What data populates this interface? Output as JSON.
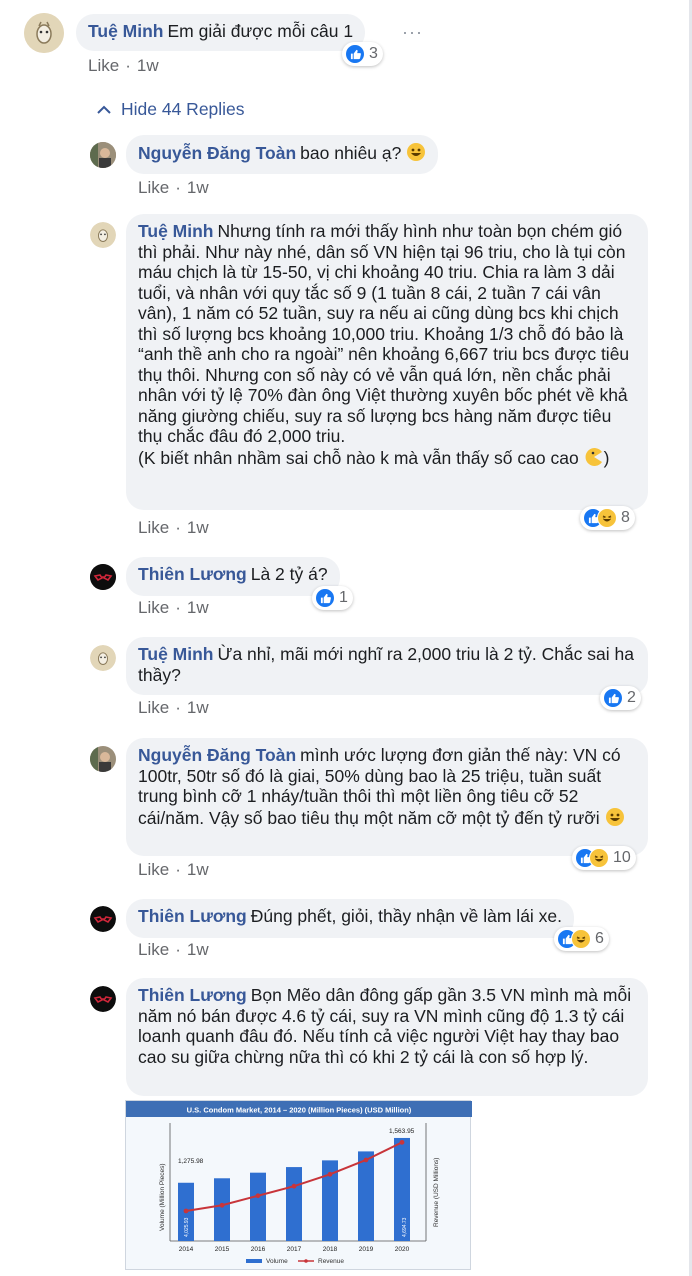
{
  "top": {
    "author": "Tuệ Minh",
    "text": "Em giải được mỗi câu 1",
    "reaction_count": "3",
    "like": "Like",
    "time": "1w",
    "more": "···"
  },
  "hide_replies": "Hide 44 Replies",
  "replies": [
    {
      "author": "Nguyễn Đăng Toàn",
      "text": "bao nhiêu ạ?",
      "like": "Like",
      "time": "1w"
    },
    {
      "author": "Tuệ Minh",
      "text": "Nhưng tính ra mới thấy hình như toàn bọn chém gió thì phải. Như này nhé, dân số VN hiện tại 96 triu, cho là tụi còn máu chịch là từ 15-50, vị chi khoảng 40 triu. Chia ra làm 3 dải tuổi, và nhân với quy tắc số 9 (1 tuần 8 cái, 2 tuần 7 cái vân vân), 1 năm có 52 tuần, suy ra nếu ai cũng dùng bcs khi chịch thì số lượng bcs khoảng 10,000 triu. Khoảng 1/3 chỗ đó bảo là “anh thề anh cho ra ngoài” nên khoảng 6,667 triu bcs được tiêu thụ thôi. Nhưng con số này có vẻ vẫn quá lớn, nền chắc phải nhân với tỷ lệ 70% đàn ông Việt thường xuyên bốc phét về khả năng giường chiếu, suy ra số lượng bcs hàng năm được tiêu thụ chắc đâu đó 2,000 triu.\n(K biết nhân nhầm sai chỗ nào k mà vẫn thấy số cao cao",
      "text_end": ")",
      "reaction_count": "8",
      "like": "Like",
      "time": "1w"
    },
    {
      "author": "Thiên Lương",
      "text": "Là 2 tỷ á?",
      "reaction_count": "1",
      "like": "Like",
      "time": "1w"
    },
    {
      "author": "Tuệ Minh",
      "text": "Ừa nhỉ, mãi mới nghĩ ra 2,000 triu là 2 tỷ. Chắc sai ha thầy?",
      "reaction_count": "2",
      "like": "Like",
      "time": "1w"
    },
    {
      "author": "Nguyễn Đăng Toàn",
      "text": "mình ước lượng đơn giản thế này: VN có 100tr, 50tr số đó là giai, 50% dùng bao là 25 triệu, tuần suất trung bình cỡ 1 nháy/tuần thôi thì một liền ông tiêu cỡ 52 cái/năm. Vậy số bao tiêu thụ một năm cỡ một tỷ đến tỷ rưỡi",
      "reaction_count": "10",
      "like": "Like",
      "time": "1w"
    },
    {
      "author": "Thiên Lương",
      "text": "Đúng phết, giỏi, thầy nhận về làm lái xe.",
      "reaction_count": "6",
      "like": "Like",
      "time": "1w"
    },
    {
      "author": "Thiên Lương",
      "text": "Bọn Mẽo dân đông gấp gần 3.5 VN mình mà mỗi năm nó bán được 4.6 tỷ cái, suy ra VN mình cũng độ 1.3 tỷ cái loanh quanh đâu đó. Nếu tính cả việc người Việt hay thay bao cao su giữa chừng nữa thì có khi 2 tỷ cái là con số hợp lý."
    }
  ],
  "chart_data": {
    "type": "bar",
    "title": "U.S. Condom Market, 2014 – 2020 (Million Pieces) (USD Million)",
    "categories": [
      "2014",
      "2015",
      "2016",
      "2017",
      "2018",
      "2019",
      "2020"
    ],
    "series": [
      {
        "name": "Volume",
        "values": [
          520,
          560,
          610,
          660,
          720,
          800,
          920
        ]
      },
      {
        "name": "Revenue",
        "values": [
          1275.98,
          1300,
          1340,
          1380,
          1430,
          1490,
          1563.95
        ]
      }
    ],
    "value_labels": {
      "first": "1,275.98",
      "last": "1,563.95",
      "bar_first": "4,025.93",
      "bar_last": "4,694.73"
    },
    "ylabel": "Volume (Million Pieces)",
    "ylabel_right": "Revenue (USD Millions)",
    "colors": {
      "volume": "#2f6fd0",
      "revenue": "#c8353a",
      "title_bg": "#3e6fb5"
    }
  },
  "colors": {
    "name": "#385898",
    "bubble": "#f0f2f5",
    "meta": "#65676b",
    "like_blue": "#1877f2",
    "haha_yellow": "#f7c33a"
  }
}
